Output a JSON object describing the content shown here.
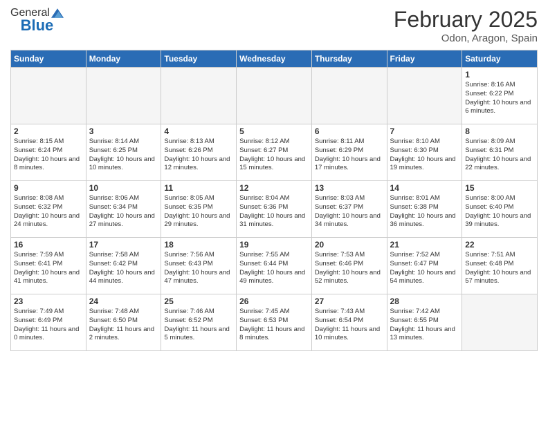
{
  "logo": {
    "general": "General",
    "blue": "Blue"
  },
  "header": {
    "title": "February 2025",
    "subtitle": "Odon, Aragon, Spain"
  },
  "weekdays": [
    "Sunday",
    "Monday",
    "Tuesday",
    "Wednesday",
    "Thursday",
    "Friday",
    "Saturday"
  ],
  "weeks": [
    [
      {
        "day": "",
        "info": ""
      },
      {
        "day": "",
        "info": ""
      },
      {
        "day": "",
        "info": ""
      },
      {
        "day": "",
        "info": ""
      },
      {
        "day": "",
        "info": ""
      },
      {
        "day": "",
        "info": ""
      },
      {
        "day": "1",
        "info": "Sunrise: 8:16 AM\nSunset: 6:22 PM\nDaylight: 10 hours and 6 minutes."
      }
    ],
    [
      {
        "day": "2",
        "info": "Sunrise: 8:15 AM\nSunset: 6:24 PM\nDaylight: 10 hours and 8 minutes."
      },
      {
        "day": "3",
        "info": "Sunrise: 8:14 AM\nSunset: 6:25 PM\nDaylight: 10 hours and 10 minutes."
      },
      {
        "day": "4",
        "info": "Sunrise: 8:13 AM\nSunset: 6:26 PM\nDaylight: 10 hours and 12 minutes."
      },
      {
        "day": "5",
        "info": "Sunrise: 8:12 AM\nSunset: 6:27 PM\nDaylight: 10 hours and 15 minutes."
      },
      {
        "day": "6",
        "info": "Sunrise: 8:11 AM\nSunset: 6:29 PM\nDaylight: 10 hours and 17 minutes."
      },
      {
        "day": "7",
        "info": "Sunrise: 8:10 AM\nSunset: 6:30 PM\nDaylight: 10 hours and 19 minutes."
      },
      {
        "day": "8",
        "info": "Sunrise: 8:09 AM\nSunset: 6:31 PM\nDaylight: 10 hours and 22 minutes."
      }
    ],
    [
      {
        "day": "9",
        "info": "Sunrise: 8:08 AM\nSunset: 6:32 PM\nDaylight: 10 hours and 24 minutes."
      },
      {
        "day": "10",
        "info": "Sunrise: 8:06 AM\nSunset: 6:34 PM\nDaylight: 10 hours and 27 minutes."
      },
      {
        "day": "11",
        "info": "Sunrise: 8:05 AM\nSunset: 6:35 PM\nDaylight: 10 hours and 29 minutes."
      },
      {
        "day": "12",
        "info": "Sunrise: 8:04 AM\nSunset: 6:36 PM\nDaylight: 10 hours and 31 minutes."
      },
      {
        "day": "13",
        "info": "Sunrise: 8:03 AM\nSunset: 6:37 PM\nDaylight: 10 hours and 34 minutes."
      },
      {
        "day": "14",
        "info": "Sunrise: 8:01 AM\nSunset: 6:38 PM\nDaylight: 10 hours and 36 minutes."
      },
      {
        "day": "15",
        "info": "Sunrise: 8:00 AM\nSunset: 6:40 PM\nDaylight: 10 hours and 39 minutes."
      }
    ],
    [
      {
        "day": "16",
        "info": "Sunrise: 7:59 AM\nSunset: 6:41 PM\nDaylight: 10 hours and 41 minutes."
      },
      {
        "day": "17",
        "info": "Sunrise: 7:58 AM\nSunset: 6:42 PM\nDaylight: 10 hours and 44 minutes."
      },
      {
        "day": "18",
        "info": "Sunrise: 7:56 AM\nSunset: 6:43 PM\nDaylight: 10 hours and 47 minutes."
      },
      {
        "day": "19",
        "info": "Sunrise: 7:55 AM\nSunset: 6:44 PM\nDaylight: 10 hours and 49 minutes."
      },
      {
        "day": "20",
        "info": "Sunrise: 7:53 AM\nSunset: 6:46 PM\nDaylight: 10 hours and 52 minutes."
      },
      {
        "day": "21",
        "info": "Sunrise: 7:52 AM\nSunset: 6:47 PM\nDaylight: 10 hours and 54 minutes."
      },
      {
        "day": "22",
        "info": "Sunrise: 7:51 AM\nSunset: 6:48 PM\nDaylight: 10 hours and 57 minutes."
      }
    ],
    [
      {
        "day": "23",
        "info": "Sunrise: 7:49 AM\nSunset: 6:49 PM\nDaylight: 11 hours and 0 minutes."
      },
      {
        "day": "24",
        "info": "Sunrise: 7:48 AM\nSunset: 6:50 PM\nDaylight: 11 hours and 2 minutes."
      },
      {
        "day": "25",
        "info": "Sunrise: 7:46 AM\nSunset: 6:52 PM\nDaylight: 11 hours and 5 minutes."
      },
      {
        "day": "26",
        "info": "Sunrise: 7:45 AM\nSunset: 6:53 PM\nDaylight: 11 hours and 8 minutes."
      },
      {
        "day": "27",
        "info": "Sunrise: 7:43 AM\nSunset: 6:54 PM\nDaylight: 11 hours and 10 minutes."
      },
      {
        "day": "28",
        "info": "Sunrise: 7:42 AM\nSunset: 6:55 PM\nDaylight: 11 hours and 13 minutes."
      },
      {
        "day": "",
        "info": ""
      }
    ]
  ]
}
